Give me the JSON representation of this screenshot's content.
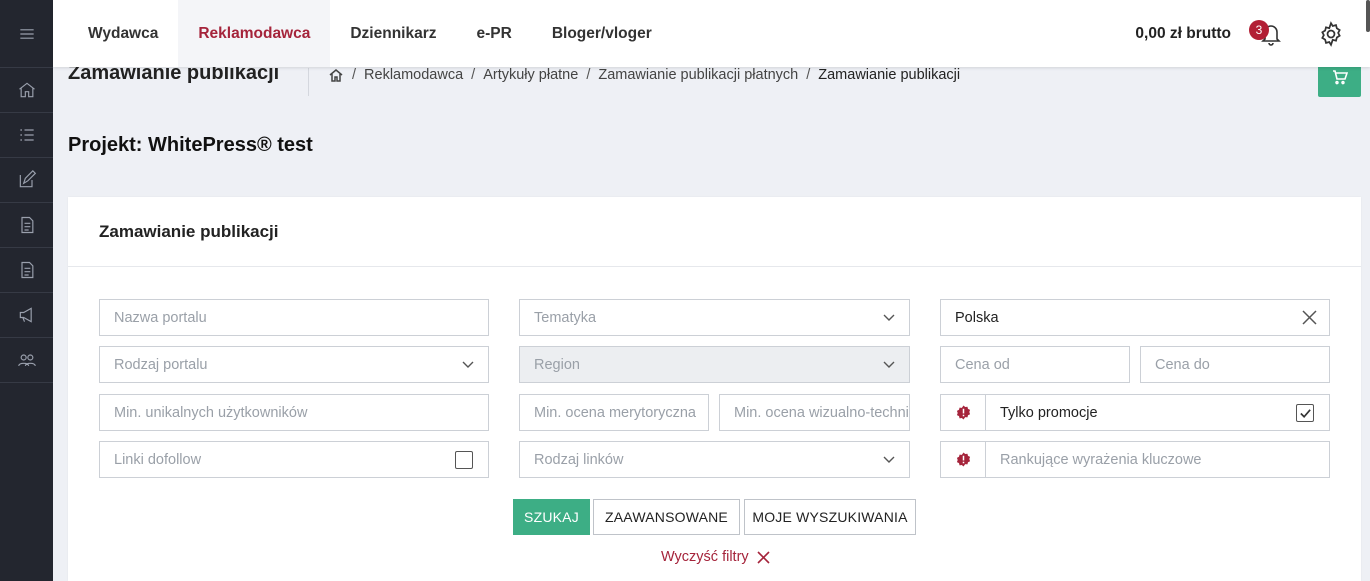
{
  "nav": {
    "tabs": [
      "Wydawca",
      "Reklamodawca",
      "Dziennikarz",
      "e-PR",
      "Bloger/vloger"
    ],
    "active_tab": "Reklamodawca",
    "price": "0,00 zł brutto",
    "notifications_count": "3"
  },
  "sidebar": {
    "icons": [
      "menu-icon",
      "home-icon",
      "list-icon",
      "edit-icon",
      "document-icon",
      "document-icon",
      "megaphone-icon",
      "users-icon"
    ]
  },
  "page": {
    "title": "Zamawianie publikacji",
    "breadcrumb": [
      "Reklamodawca",
      "Artykuły płatne",
      "Zamawianie publikacji płatnych",
      "Zamawianie publikacji"
    ],
    "project": "Projekt: WhitePress® test"
  },
  "card": {
    "title": "Zamawianie publikacji",
    "fields": {
      "portal_name": "Nazwa portalu",
      "portal_type": "Rodzaj portalu",
      "min_unique_users": "Min. unikalnych użytkowników",
      "dofollow_links": "Linki dofollow",
      "topic": "Tematyka",
      "region": "Region",
      "min_content_rating": "Min. ocena merytoryczna",
      "min_visual_rating": "Min. ocena wizualno-techniczna",
      "link_type": "Rodzaj linków",
      "country": "Polska",
      "price_from": "Cena od",
      "price_to": "Cena do",
      "only_promotions": "Tylko promocje",
      "only_promotions_checked": true,
      "keywords": "Rankujące wyrażenia kluczowe"
    },
    "buttons": {
      "search": "SZUKAJ",
      "advanced": "ZAAWANSOWANE",
      "my_searches": "MOJE WYSZUKIWANIA"
    },
    "clear_filters": "Wyczyść filtry"
  },
  "colors": {
    "accent": "#a5243b",
    "primary": "#3dae85",
    "sidebar": "#23262f"
  }
}
